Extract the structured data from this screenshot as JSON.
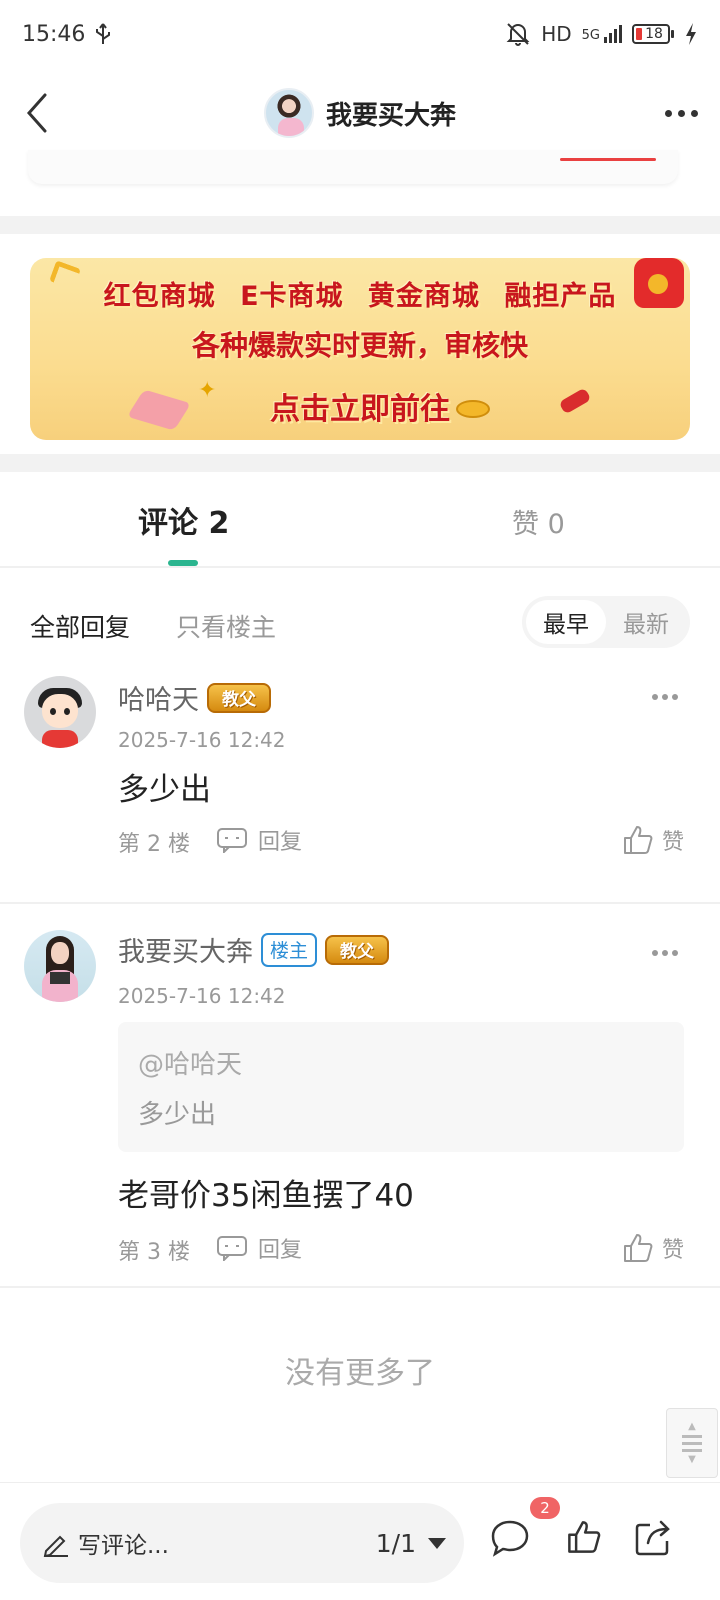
{
  "status_bar": {
    "time": "15:46",
    "network_label": "HD",
    "signal_label": "5G",
    "battery_level": "18"
  },
  "header": {
    "title": "我要买大奔"
  },
  "banner": {
    "line1": "红包商城 E卡商城 黄金商城 融担产品",
    "line2": "各种爆款实时更新，审核快",
    "cta": "点击立即前往"
  },
  "tabs": {
    "comments_label": "评论",
    "comments_count": "2",
    "likes_label": "赞",
    "likes_count": "0"
  },
  "filters": {
    "all_replies": "全部回复",
    "only_op": "只看楼主",
    "sort_earliest": "最早",
    "sort_latest": "最新",
    "active_sort": "最早"
  },
  "comments": [
    {
      "username": "哈哈天",
      "badge": "教父",
      "time": "2025-7-16 12:42",
      "text": "多少出",
      "floor": "第 2 楼",
      "reply_label": "回复",
      "like_label": "赞"
    },
    {
      "username": "我要买大奔",
      "op_badge": "楼主",
      "badge": "教父",
      "time": "2025-7-16 12:42",
      "quote_mention": "@哈哈天",
      "quote_text": "多少出",
      "text": "老哥价35闲鱼摆了40",
      "floor": "第 3 楼",
      "reply_label": "回复",
      "like_label": "赞"
    }
  ],
  "footer_note": "没有更多了",
  "bottom_bar": {
    "compose_placeholder": "写评论...",
    "page": "1/1",
    "comment_badge": "2"
  }
}
